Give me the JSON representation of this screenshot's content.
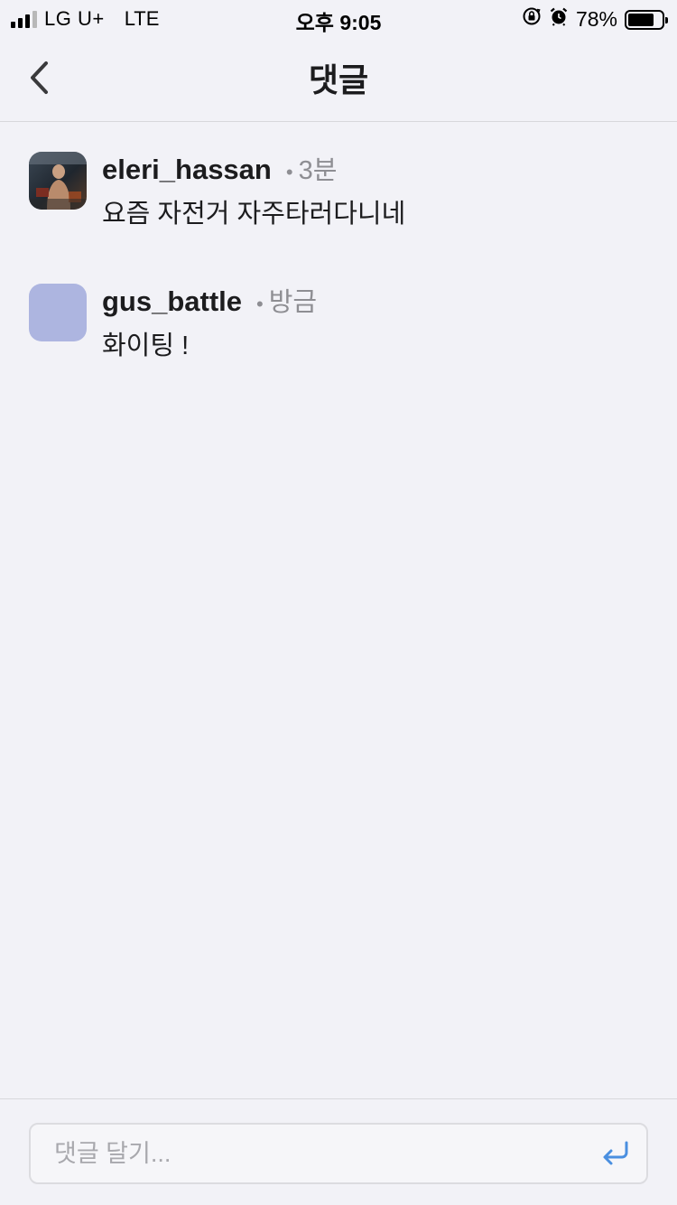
{
  "status_bar": {
    "carrier": "LG U+",
    "network": "LTE",
    "time": "오후 9:05",
    "battery_percent": "78%",
    "battery_level": 0.78
  },
  "nav": {
    "title": "댓글",
    "back_icon": "chevron-left-icon"
  },
  "comments": [
    {
      "username": "eleri_hassan",
      "dot": "•",
      "time": "3분",
      "text": "요즘 자전거 자주타러다니네",
      "avatar": "photo"
    },
    {
      "username": "gus_battle",
      "dot": "•",
      "time": "방금",
      "text": "화이팅 !",
      "avatar_color": "#adb5e0"
    }
  ],
  "input": {
    "placeholder": "댓글 달기...",
    "value": "",
    "send_icon": "return-arrow-icon"
  },
  "colors": {
    "accent": "#4a8fe0",
    "background": "#f2f2f7",
    "muted": "#8e8e93"
  }
}
